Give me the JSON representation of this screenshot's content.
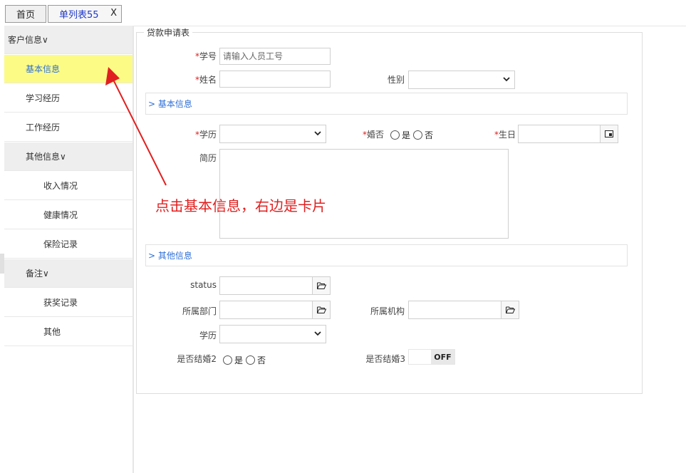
{
  "tabs": {
    "home": "首页",
    "active": "单列表55",
    "close": "X"
  },
  "sidebar": {
    "items": [
      {
        "label": "客户信息∨"
      },
      {
        "label": "基本信息"
      },
      {
        "label": "学习经历"
      },
      {
        "label": "工作经历"
      },
      {
        "label": "其他信息∨"
      },
      {
        "label": "收入情况"
      },
      {
        "label": "健康情况"
      },
      {
        "label": "保险记录"
      },
      {
        "label": "备注∨"
      },
      {
        "label": "获奖记录"
      },
      {
        "label": "其他"
      }
    ]
  },
  "form": {
    "title": "贷款申请表",
    "student_no": {
      "label": "学号",
      "placeholder": "请输入人员工号"
    },
    "name": {
      "label": "姓名"
    },
    "gender": {
      "label": "性别"
    },
    "section_basic": "> 基本信息",
    "education": {
      "label": "学历"
    },
    "married": {
      "label": "婚否",
      "opt_yes": "是",
      "opt_no": "否"
    },
    "birthday": {
      "label": "生日"
    },
    "resume": {
      "label": "简历"
    },
    "section_other": "> 其他信息",
    "status": {
      "label": "status"
    },
    "department": {
      "label": "所属部门"
    },
    "organization": {
      "label": "所属机构"
    },
    "education2": {
      "label": "学历"
    },
    "married2": {
      "label": "是否结婚2",
      "opt_yes": "是",
      "opt_no": "否"
    },
    "married3": {
      "label": "是否结婚3",
      "toggle": "OFF"
    }
  },
  "annotation": "点击基本信息，右边是卡片",
  "colors": {
    "selected_bg": "#fcfb86",
    "link": "#2e6fd6",
    "required": "#e02020",
    "annotation": "#e02020"
  }
}
